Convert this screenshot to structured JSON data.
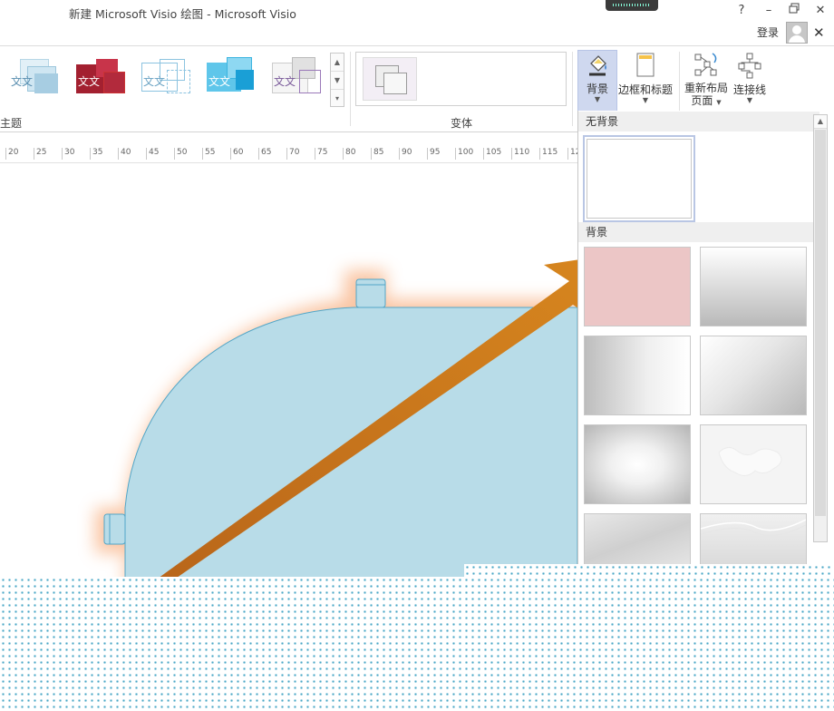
{
  "window": {
    "title": "新建 Microsoft Visio 绘图 - Microsoft Visio",
    "help": "?",
    "minimize": "–",
    "restore": "🗗",
    "close": "✕",
    "signin": "登录",
    "close_pane": "✕"
  },
  "ribbon": {
    "themes_group_label": "主题",
    "theme_tiles": [
      {
        "text": "文文",
        "fill": "#cfe6f2",
        "accent": "#7fb6d3"
      },
      {
        "text": "文文",
        "fill": "#a32030",
        "accent": "#c8344a"
      },
      {
        "text": "文文",
        "fill": "#e9f3f9",
        "accent": "#8cc3e0"
      },
      {
        "text": "文文",
        "fill": "#5fc6ea",
        "accent": "#1a9fd6"
      },
      {
        "text": "文文",
        "fill": "#f1f1f1",
        "accent": "#9a79b9"
      }
    ],
    "variants_group_label": "变体",
    "background_button": "背景",
    "borders_titles_button": "边框和标题",
    "relayout_button": "重新布局",
    "relayout_sub": "页面",
    "connectors_button": "连接线"
  },
  "ruler": {
    "ticks": [
      "20",
      "25",
      "30",
      "35",
      "40",
      "45",
      "50",
      "55",
      "60",
      "65",
      "70",
      "75",
      "80",
      "85",
      "90",
      "95",
      "100",
      "105",
      "110",
      "115",
      "12"
    ]
  },
  "gallery": {
    "no_background_header": "无背景",
    "background_header": "背景"
  },
  "colors": {
    "shape_fill": "#b8dce8",
    "shape_stroke": "#52a6c8",
    "glow": "#f5a36e",
    "arrow": "#c97a1c",
    "selected_tile_border": "#b9c6e4"
  }
}
